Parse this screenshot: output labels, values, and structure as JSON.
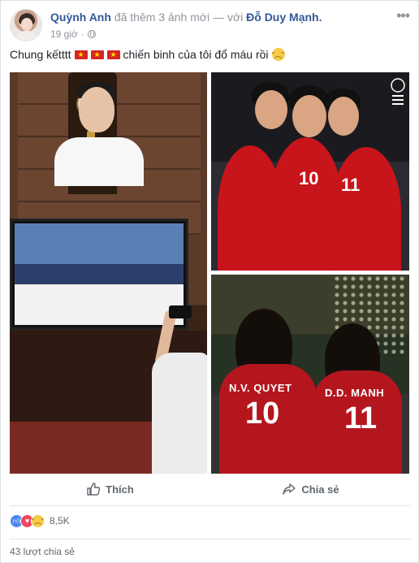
{
  "post": {
    "author": "Quỳnh Anh",
    "action_text": "đã thêm 3 ảnh mới — với",
    "tagged": "Đỗ Duy Mạnh.",
    "time": "19 giờ",
    "privacy_icon": "globe-icon",
    "menu_icon": "more-icon",
    "status_prefix": "Chung kếtttt",
    "status_suffix": "chiến binh của tôi đổ máu rồi",
    "flag_count": 3
  },
  "photos": {
    "top_right_numbers": [
      "10",
      "11"
    ],
    "bottom_right_jerseys": [
      {
        "name": "N.V. QUYET",
        "number": "10"
      },
      {
        "name": "D.D. MANH",
        "number": "11"
      }
    ]
  },
  "actions": {
    "like_label": "Thích",
    "share_label": "Chia sẻ"
  },
  "reactions": {
    "count": "8,5K"
  },
  "shares": {
    "label": "43 lượt chia sẻ"
  },
  "colors": {
    "link": "#365899",
    "vn_red": "#da251d",
    "vn_star": "#ffdf00"
  }
}
